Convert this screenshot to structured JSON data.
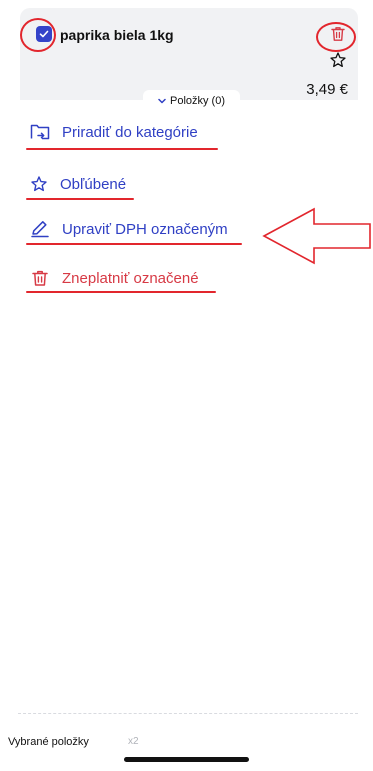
{
  "item": {
    "name": "paprika biela 1kg",
    "price": "3,49 €",
    "checked": true
  },
  "tab": {
    "label": "Položky (0)"
  },
  "menu": {
    "assign_category": "Priradiť do kategórie",
    "favorites": "Obľúbené",
    "edit_vat": "Upraviť DPH označeným",
    "invalidate": "Zneplatniť označené"
  },
  "footer": {
    "label": "Vybrané položky",
    "count": "x2"
  },
  "colors": {
    "accent_blue": "#3040c4",
    "danger_red": "#d73a45",
    "annotation_red": "#e2262d"
  },
  "icons": [
    "check-icon",
    "trash-icon",
    "star-icon",
    "chevron-down-icon",
    "folder-arrow-icon",
    "pencil-icon"
  ]
}
